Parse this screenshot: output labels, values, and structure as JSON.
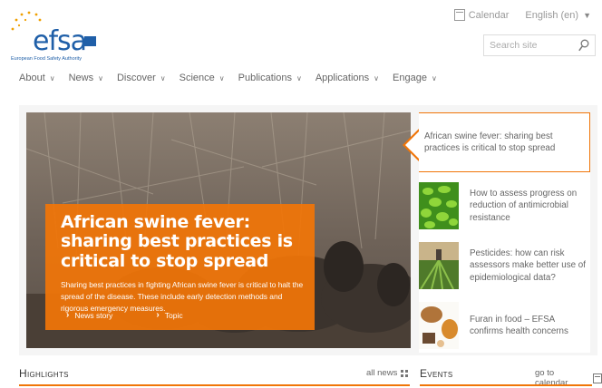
{
  "brand": {
    "logo_text": "efsa",
    "subtitle": "European Food Safety Authority",
    "accent": "#f07508",
    "brand_blue": "#1f5fa8"
  },
  "header": {
    "calendar_label": "Calendar",
    "language_label": "English (en)",
    "search_placeholder": "Search site"
  },
  "nav": {
    "items": [
      {
        "label": "About"
      },
      {
        "label": "News"
      },
      {
        "label": "Discover"
      },
      {
        "label": "Science"
      },
      {
        "label": "Publications"
      },
      {
        "label": "Applications"
      },
      {
        "label": "Engage"
      }
    ]
  },
  "hero": {
    "title": "African swine fever: sharing best practices is critical to stop spread",
    "text": "Sharing best practices in fighting African swine fever is critical to halt the spread of the disease. These include early detection methods and rigorous emergency measures.",
    "link_news": "News story",
    "link_topic": "Topic"
  },
  "side_list": {
    "items": [
      {
        "label": "African swine fever: sharing best practices is critical to stop spread",
        "thumb": "none"
      },
      {
        "label": "How to assess progress on reduction of antimicrobial resistance",
        "thumb": "bacteria-icon"
      },
      {
        "label": "Pesticides: how can risk assessors make better use of epidemiological data?",
        "thumb": "field-icon"
      },
      {
        "label": "Furan in food – EFSA confirms health concerns",
        "thumb": "food-icon"
      }
    ]
  },
  "sections": {
    "highlights_title": "Highlights",
    "highlights_link": "all news",
    "events_title": "Events",
    "events_link": "go to calendar"
  }
}
